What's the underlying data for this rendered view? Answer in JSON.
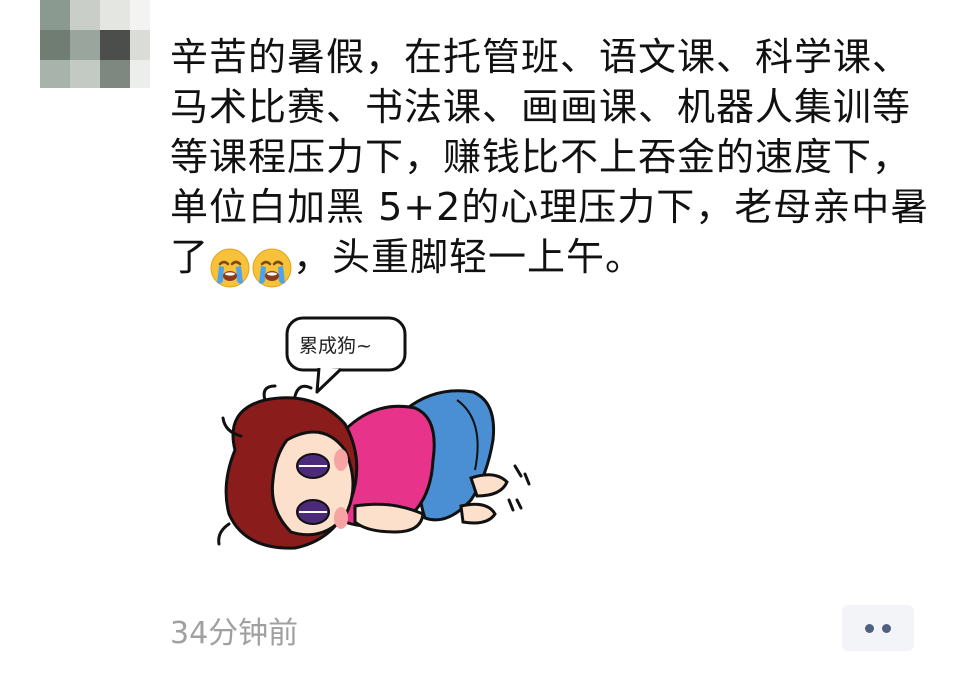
{
  "post": {
    "text_part1": "辛苦的暑假，在托管班、语文课、科学课、马术比赛、书法课、画画课、机器人集训等等课程压力下，赚钱比不上吞金的速度下，单位白加黑 5+2的心理压力下，老母亲中暑了",
    "emojis": [
      "loudly-crying-face-icon",
      "loudly-crying-face-icon"
    ],
    "text_part2": "，头重脚轻一上午。",
    "speech_bubble": "累成狗~",
    "timestamp": "34分钟前"
  },
  "colors": {
    "text": "#111111",
    "timestamp": "#a0a0a0",
    "more_button_bg": "#f2f4f7",
    "more_dots": "#4f5f80",
    "shirt": "#e8338a",
    "pants": "#4a8fd4",
    "hair": "#8a1c1c"
  }
}
